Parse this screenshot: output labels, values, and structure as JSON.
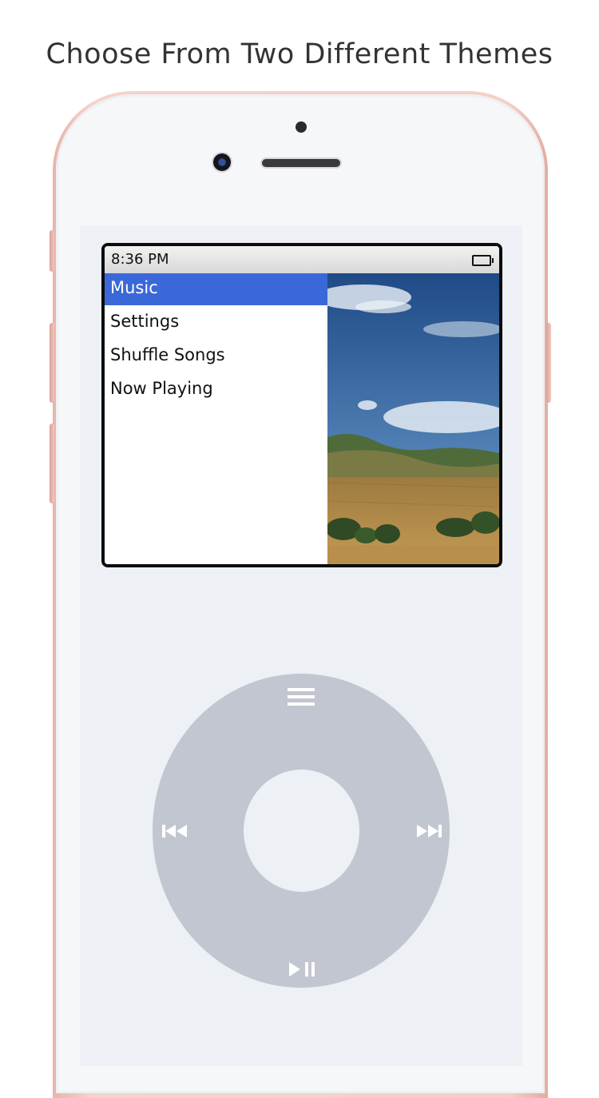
{
  "headline": "Choose From Two Different Themes",
  "status_bar": {
    "time": "8:36 PM",
    "battery_icon": "battery-icon"
  },
  "menu": {
    "items": [
      {
        "label": "Music",
        "selected": true
      },
      {
        "label": "Settings",
        "selected": false
      },
      {
        "label": "Shuffle Songs",
        "selected": false
      },
      {
        "label": "Now Playing",
        "selected": false
      }
    ]
  },
  "wheel": {
    "menu_icon": "menu-icon",
    "previous_icon": "previous-icon",
    "next_icon": "next-icon",
    "play_pause_icon": "play-pause-icon"
  },
  "colors": {
    "selection": "#3b68d8",
    "wheel": "#c2c6d0",
    "phone_frame": "#f4cfc7"
  }
}
